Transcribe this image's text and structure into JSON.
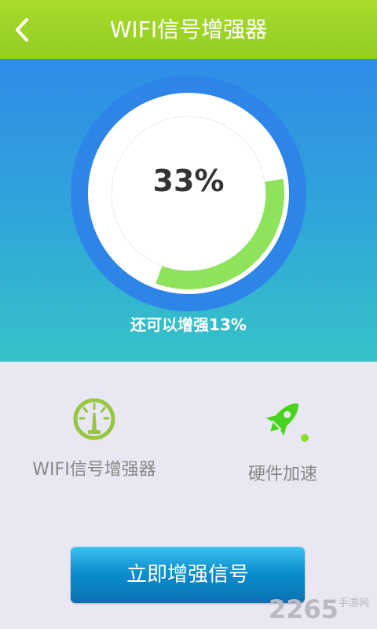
{
  "header": {
    "title": "WIFI信号增强器",
    "back_icon": "chevron-left-icon"
  },
  "gauge": {
    "percent_text": "33%",
    "progress": 0.33,
    "boost_text": "还可以增强13%",
    "colors": {
      "ring": "#2d85e8",
      "fill": "#8fe35a",
      "inner": "#ffffff"
    }
  },
  "features": [
    {
      "icon": "speedometer-icon",
      "label": "WIFI信号增强器"
    },
    {
      "icon": "rocket-icon",
      "label": "硬件加速"
    }
  ],
  "cta": {
    "label": "立即增强信号"
  },
  "watermark": {
    "text": "2265",
    "sub": "手游网"
  }
}
